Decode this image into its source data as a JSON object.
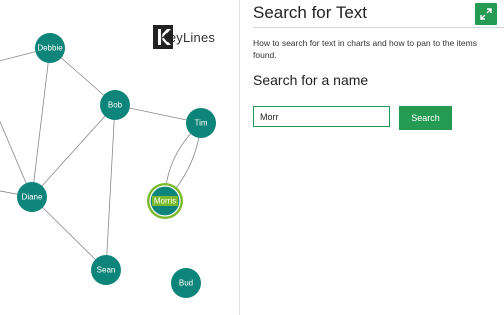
{
  "logo": {
    "text": "KeyLines"
  },
  "colors": {
    "node": "#0e857a",
    "edge": "#888888",
    "highlight": "#7ab929",
    "accent": "#259a53"
  },
  "graph": {
    "nodes": [
      {
        "id": "debbie",
        "label": "Debbie",
        "highlighted": false
      },
      {
        "id": "bob",
        "label": "Bob",
        "highlighted": false
      },
      {
        "id": "tim",
        "label": "Tim",
        "highlighted": false
      },
      {
        "id": "diane",
        "label": "Diane",
        "highlighted": false
      },
      {
        "id": "morris",
        "label": "Morris",
        "highlighted": true
      },
      {
        "id": "sean",
        "label": "Sean",
        "highlighted": false
      },
      {
        "id": "bud",
        "label": "Bud",
        "highlighted": false
      }
    ],
    "edges": [
      [
        "debbie",
        "bob"
      ],
      [
        "debbie",
        "diane"
      ],
      [
        "bob",
        "tim"
      ],
      [
        "bob",
        "diane"
      ],
      [
        "bob",
        "sean"
      ],
      [
        "diane",
        "sean"
      ],
      [
        "tim",
        "morris"
      ]
    ]
  },
  "panel": {
    "title": "Search for Text",
    "expand_icon": "expand-icon",
    "description": "How to search for text in charts and how to pan to the items found.",
    "section_title": "Search for a name",
    "search": {
      "value": "Morr",
      "placeholder": ""
    },
    "search_button": "Search"
  }
}
